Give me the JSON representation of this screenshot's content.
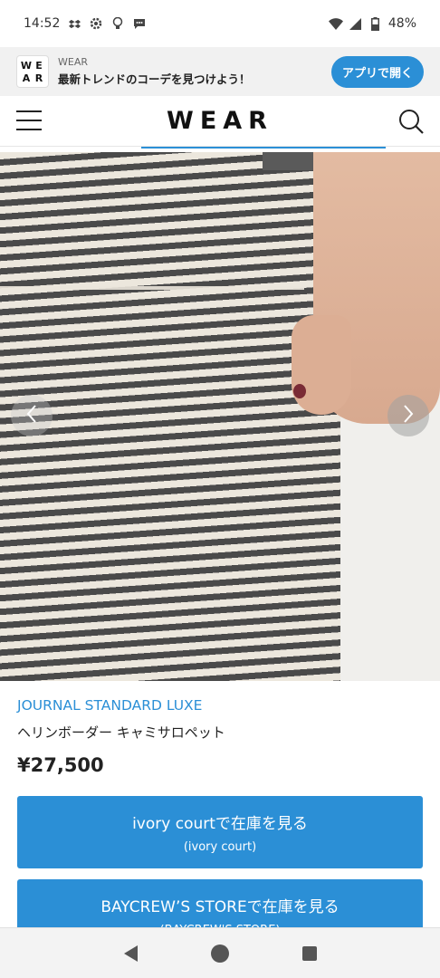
{
  "status_bar": {
    "time": "14:52",
    "battery": "48%",
    "icons": [
      "dropbox-icon",
      "settings-icon",
      "lightbulb-icon",
      "chat-icon",
      "wifi-icon",
      "signal-icon",
      "battery-icon"
    ]
  },
  "app_banner": {
    "logo_letters": [
      "W",
      "E",
      "A",
      "R"
    ],
    "app_name": "WEAR",
    "message": "最新トレンドのコーデを見つけよう！",
    "open_button": "アプリで開く",
    "accent_color": "#2b8fd6"
  },
  "header": {
    "title": "WEAR"
  },
  "carousel": {
    "prev_icon": "chevron-left-icon",
    "next_icon": "chevron-right-icon"
  },
  "product": {
    "brand": "JOURNAL STANDARD LUXE",
    "name": "ヘリンボーダー キャミサロペット",
    "price": "¥27,500"
  },
  "stores": [
    {
      "label": "ivory courtで在庫を見る",
      "sub": "(ivory court)"
    },
    {
      "label": "BAYCREW’S STOREで在庫を見る",
      "sub": "(BAYCREW'S STORE)"
    }
  ]
}
